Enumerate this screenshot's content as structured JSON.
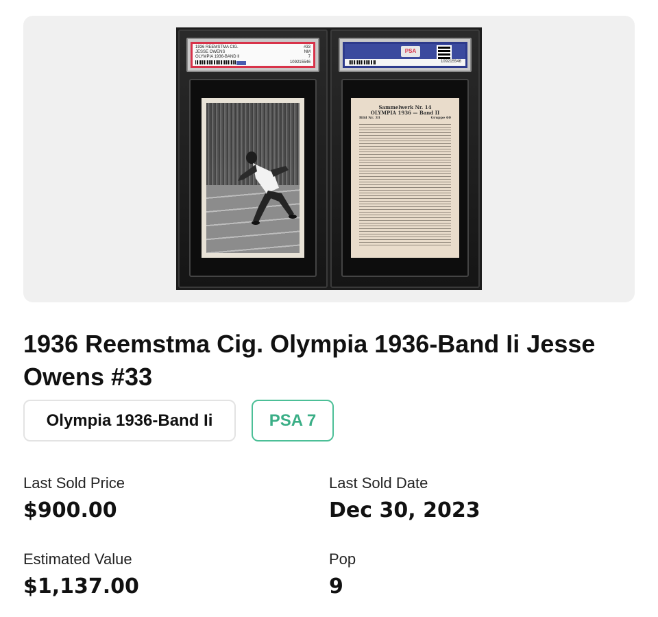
{
  "image": {
    "front_label": {
      "line1_left": "1936 REEMSTMA CIG.",
      "line1_right": "#33",
      "line2_left": "JESSE OWENS",
      "line2_right": "NM",
      "line3_left": "OLYMPIA 1936-BAND II",
      "line3_right": "7",
      "cert": "109215546"
    },
    "back_label": {
      "logo": "PSA",
      "cert": "109215546"
    },
    "card_back": {
      "line1": "Sammelwerk Nr. 14",
      "line2": "OLYMPIA 1936 — Band II",
      "line3": "Bild Nr. 33",
      "line4": "Gruppe 60"
    }
  },
  "title": "1936 Reemstma Cig. Olympia 1936-Band Ii Jesse Owens #33",
  "chips": {
    "set": "Olympia 1936-Band Ii",
    "grade": "PSA 7"
  },
  "stats": {
    "last_sold_price_label": "Last Sold Price",
    "last_sold_price_value": "$900.00",
    "last_sold_date_label": "Last Sold Date",
    "last_sold_date_value": "Dec 30, 2023",
    "estimated_value_label": "Estimated Value",
    "estimated_value_value": "$1,137.00",
    "pop_label": "Pop",
    "pop_value": "9"
  },
  "colors": {
    "grade_accent": "#3aae86",
    "psa_red": "#d8334a",
    "psa_blue": "#3b4a9e"
  }
}
